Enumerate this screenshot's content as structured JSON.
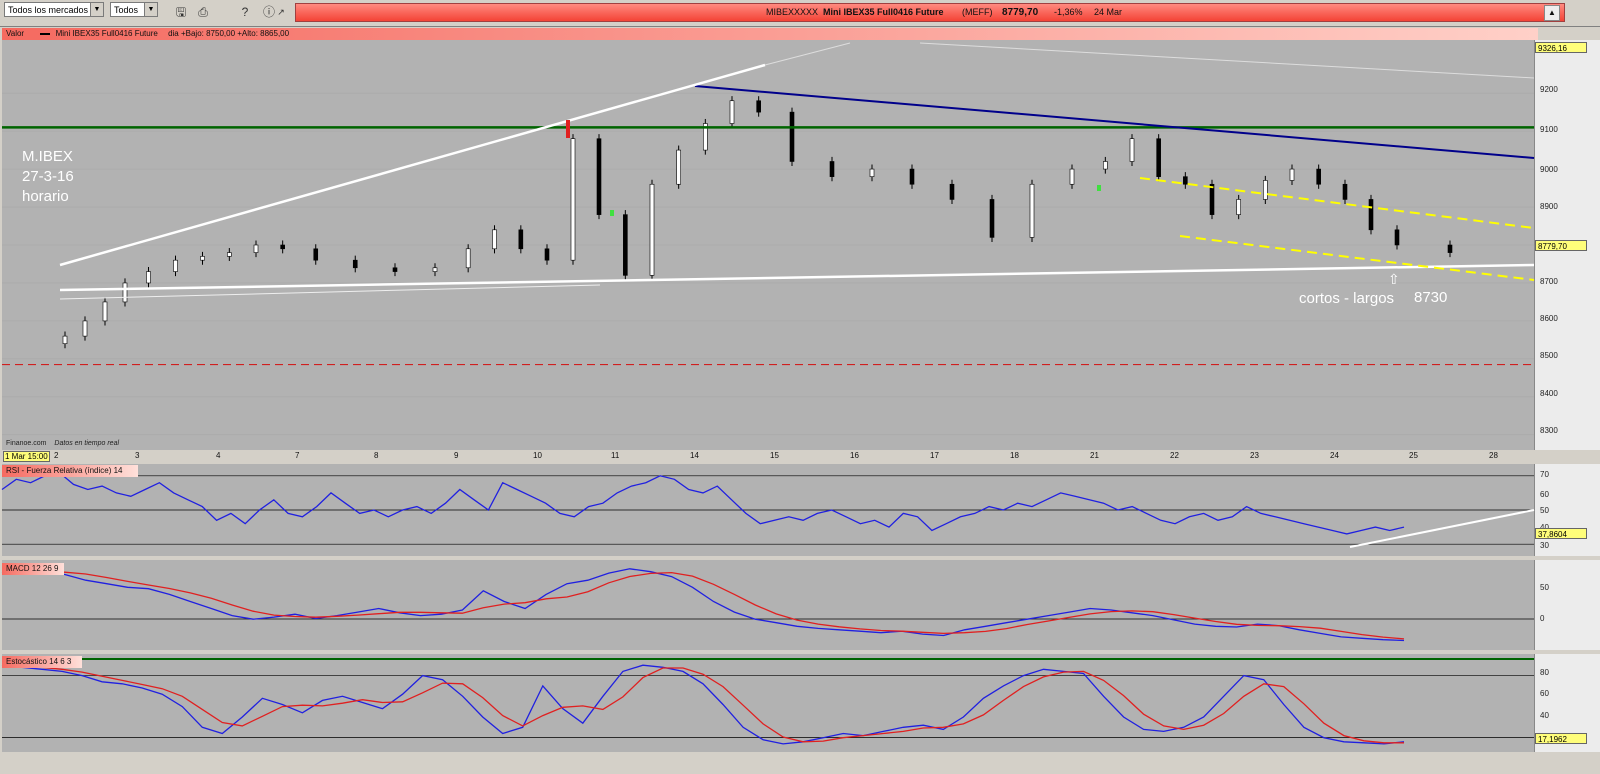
{
  "toolbar": {
    "market_select": "Todos los mercados",
    "type_select": "Todos",
    "title_code": "MIBEXXXXX",
    "title_name": "Mini IBEX35 Full0416 Future",
    "title_exchange": "(MEFF)",
    "title_price": "8779,70",
    "title_change": "-1,36%",
    "title_date": "24 Mar"
  },
  "price_panel": {
    "header": "Valor",
    "instrument": "Mini IBEX35 Full0416 Future",
    "range_text": "dia +Bajo: 8750,00 +Alto: 8865,00",
    "y_ticks": [
      "9200",
      "9100",
      "9000",
      "8900",
      "8800",
      "8700",
      "8600",
      "8500",
      "8400",
      "8300"
    ],
    "top_value": "9326,16",
    "last_value": "8779,70",
    "start_date_label": "1 Mar 15:00",
    "source": "Finanoe.com",
    "source_note": "Datos en tiempo real",
    "x_ticks": [
      "2",
      "3",
      "4",
      "7",
      "8",
      "9",
      "10",
      "11",
      "14",
      "15",
      "16",
      "17",
      "18",
      "21",
      "22",
      "23",
      "24",
      "25",
      "28"
    ]
  },
  "annotations": {
    "title_line1": "M.IBEX",
    "title_line2": "27-3-16",
    "title_line3": "horario",
    "cortos_largos": "cortos - largos",
    "level": "8730"
  },
  "rsi_panel": {
    "header": "RSI - Fuerza Relativa (índice) 14",
    "y_ticks": [
      "70",
      "60",
      "50",
      "40",
      "30"
    ],
    "last_value": "37,8604"
  },
  "macd_panel": {
    "header": "MACD 12 26 9",
    "y_ticks": [
      "50",
      "0"
    ]
  },
  "stoch_panel": {
    "header": "Estocástico 14 6 3",
    "y_ticks": [
      "80",
      "60",
      "40"
    ],
    "last_value": "17,1962"
  },
  "colors": {
    "plot_bg": "#b2b2b2",
    "trend_blue": "#00008b",
    "resistance_green": "#006400",
    "channel_yellow": "#ffff00",
    "support_red": "#d02020",
    "rsi_line": "#2020e0",
    "signal_red": "#e02020"
  },
  "chart_data": {
    "type": "candlestick",
    "title": "Mini IBEX35 Full0416 Future",
    "ylim": [
      8260,
      9340
    ],
    "levels": {
      "resistance": 9110,
      "support_dashed": 8485,
      "annotated_level": 8730
    },
    "close_path": [
      [
        "2",
        8560
      ],
      [
        "2",
        8600
      ],
      [
        "2",
        8650
      ],
      [
        "2",
        8700
      ],
      [
        "3",
        8730
      ],
      [
        "3",
        8760
      ],
      [
        "3",
        8770
      ],
      [
        "4",
        8780
      ],
      [
        "4",
        8800
      ],
      [
        "4",
        8790
      ],
      [
        "7",
        8760
      ],
      [
        "7",
        8740
      ],
      [
        "8",
        8730
      ],
      [
        "8",
        8740
      ],
      [
        "9",
        8790
      ],
      [
        "9",
        8840
      ],
      [
        "9",
        8790
      ],
      [
        "10",
        8760
      ],
      [
        "10",
        9080
      ],
      [
        "10",
        8880
      ],
      [
        "11",
        8720
      ],
      [
        "11",
        8960
      ],
      [
        "11",
        9050
      ],
      [
        "14",
        9120
      ],
      [
        "14",
        9180
      ],
      [
        "14",
        9150
      ],
      [
        "15",
        9020
      ],
      [
        "15",
        8980
      ],
      [
        "16",
        9000
      ],
      [
        "16",
        8960
      ],
      [
        "17",
        8920
      ],
      [
        "17",
        8820
      ],
      [
        "18",
        8960
      ],
      [
        "18",
        9000
      ],
      [
        "21",
        9020
      ],
      [
        "21",
        9080
      ],
      [
        "21",
        8980
      ],
      [
        "22",
        8960
      ],
      [
        "22",
        8880
      ],
      [
        "22",
        8920
      ],
      [
        "23",
        8970
      ],
      [
        "23",
        9000
      ],
      [
        "23",
        8960
      ],
      [
        "24",
        8920
      ],
      [
        "24",
        8840
      ],
      [
        "24",
        8800
      ],
      [
        "25",
        8780
      ]
    ]
  }
}
